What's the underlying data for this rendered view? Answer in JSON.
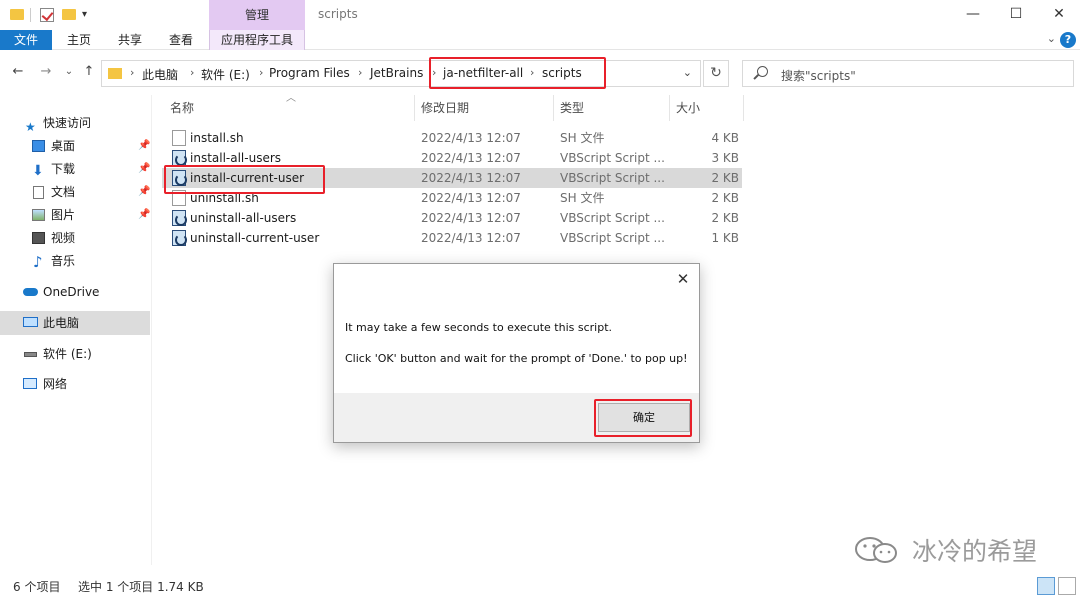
{
  "window": {
    "title": "scripts",
    "context_tab": "管理",
    "controls": {
      "minimize": "—",
      "maximize": "☐",
      "close": "✕"
    }
  },
  "ribbon": {
    "tabs": [
      "文件",
      "主页",
      "共享",
      "查看",
      "应用程序工具"
    ],
    "help": "?"
  },
  "address": {
    "crumbs": [
      "此电脑",
      "软件 (E:)",
      "Program Files",
      "JetBrains",
      "ja-netfilter-all",
      "scripts"
    ]
  },
  "search": {
    "placeholder": "搜索\"scripts\""
  },
  "sidebar": {
    "items": [
      {
        "label": "快速访问",
        "icon": "star-icon"
      },
      {
        "label": "桌面",
        "icon": "desktop-icon",
        "pinned": true
      },
      {
        "label": "下载",
        "icon": "download-icon",
        "pinned": true
      },
      {
        "label": "文档",
        "icon": "document-icon",
        "pinned": true
      },
      {
        "label": "图片",
        "icon": "picture-icon",
        "pinned": true
      },
      {
        "label": "视频",
        "icon": "video-icon"
      },
      {
        "label": "音乐",
        "icon": "music-icon"
      },
      {
        "label": "OneDrive",
        "icon": "cloud-icon"
      },
      {
        "label": "此电脑",
        "icon": "computer-icon",
        "selected": true
      },
      {
        "label": "软件 (E:)",
        "icon": "drive-icon"
      },
      {
        "label": "网络",
        "icon": "network-icon"
      }
    ]
  },
  "columns": {
    "name": "名称",
    "date": "修改日期",
    "type": "类型",
    "size": "大小"
  },
  "files": [
    {
      "name": "install.sh",
      "date": "2022/4/13 12:07",
      "type": "SH 文件",
      "size": "4 KB",
      "kind": "sh"
    },
    {
      "name": "install-all-users",
      "date": "2022/4/13 12:07",
      "type": "VBScript Script ...",
      "size": "3 KB",
      "kind": "vbs"
    },
    {
      "name": "install-current-user",
      "date": "2022/4/13 12:07",
      "type": "VBScript Script ...",
      "size": "2 KB",
      "kind": "vbs",
      "selected": true
    },
    {
      "name": "uninstall.sh",
      "date": "2022/4/13 12:07",
      "type": "SH 文件",
      "size": "2 KB",
      "kind": "sh"
    },
    {
      "name": "uninstall-all-users",
      "date": "2022/4/13 12:07",
      "type": "VBScript Script ...",
      "size": "2 KB",
      "kind": "vbs"
    },
    {
      "name": "uninstall-current-user",
      "date": "2022/4/13 12:07",
      "type": "VBScript Script ...",
      "size": "1 KB",
      "kind": "vbs"
    }
  ],
  "dialog": {
    "line1": "It may take a few seconds to execute this script.",
    "line2": "Click 'OK' button and wait for the prompt of 'Done.' to pop up!",
    "ok_label": "确定",
    "close": "✕"
  },
  "status": {
    "count": "6 个项目",
    "selection": "选中 1 个项目  1.74 KB"
  },
  "watermark": {
    "text": "冰冷的希望"
  },
  "colors": {
    "accent": "#1979ca",
    "context_tab": "#e3c9f2",
    "annotation": "#e8202a",
    "selected_row": "#d9d9d9"
  }
}
